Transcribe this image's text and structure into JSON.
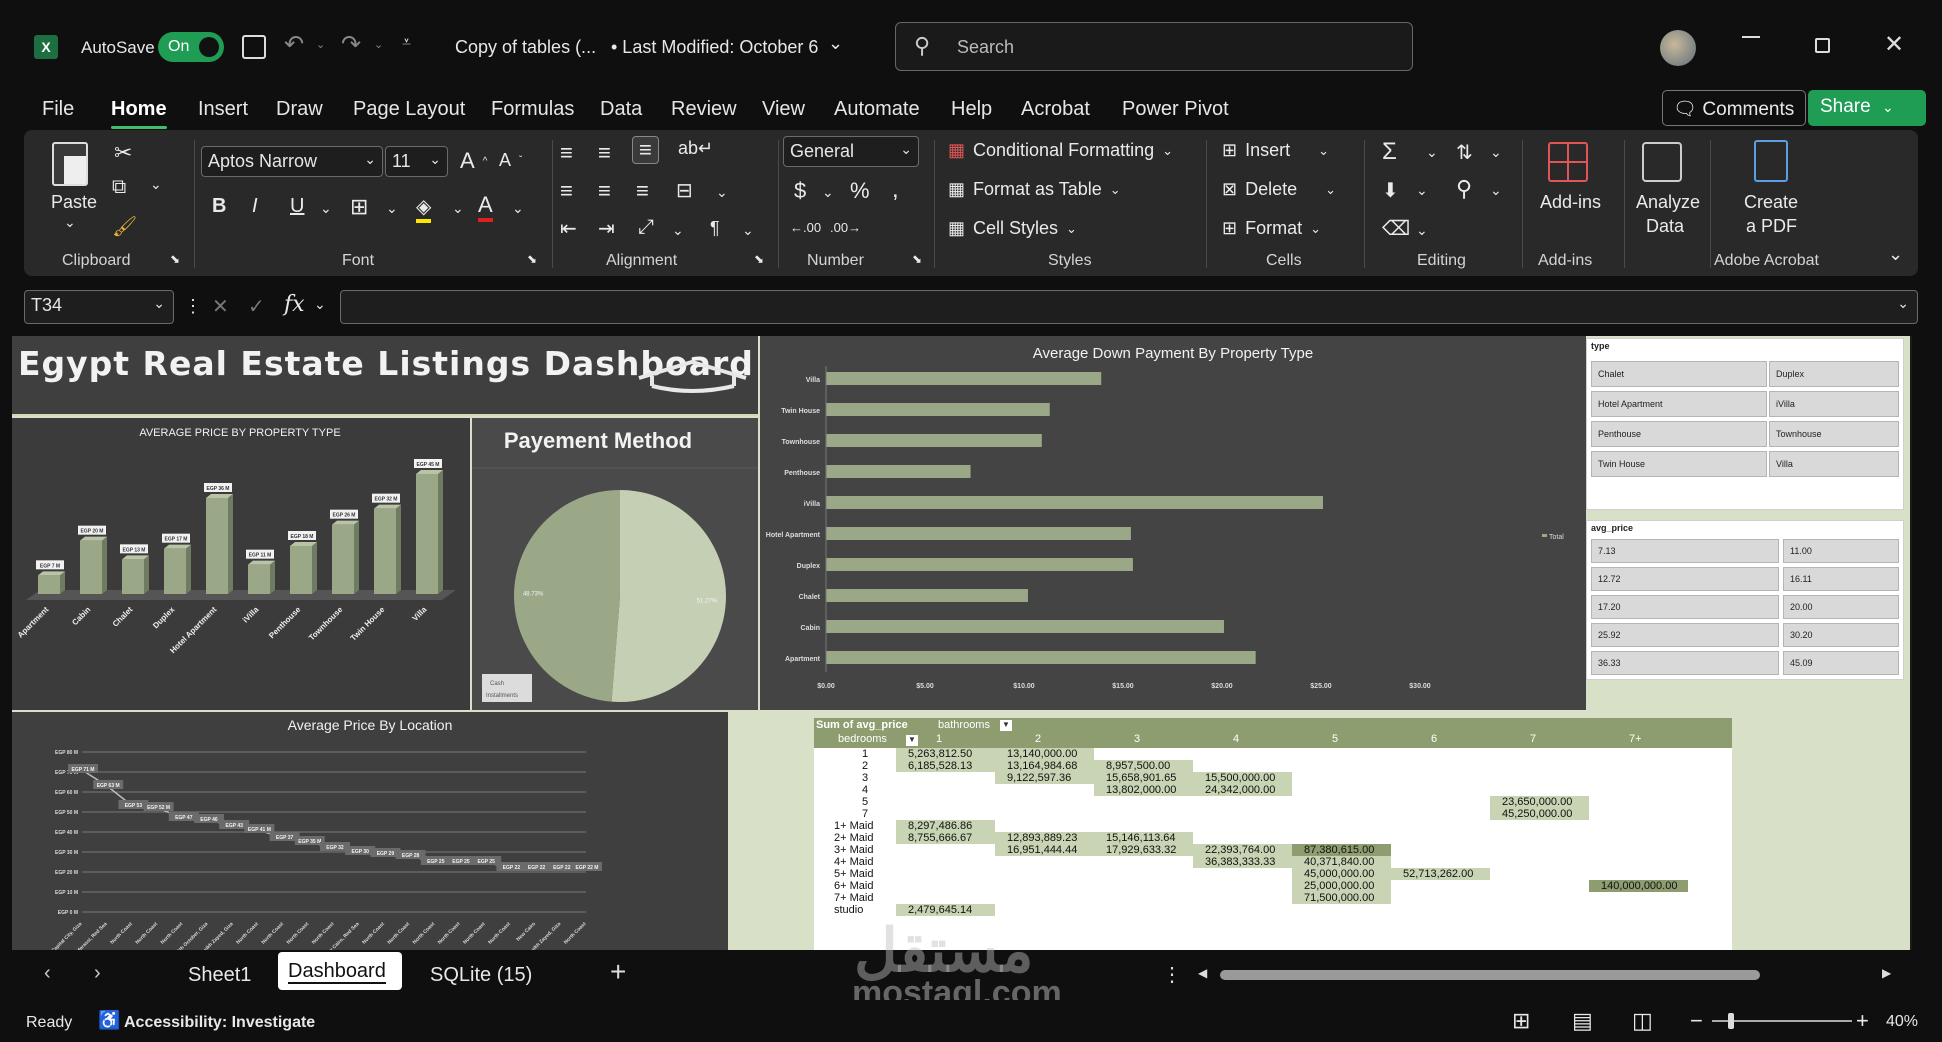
{
  "window": {
    "autosave_label": "AutoSave",
    "autosave_state": "On",
    "doc_title": "Copy of tables (...",
    "last_modified": "• Last Modified: October 6",
    "search_placeholder": "Search"
  },
  "menu": {
    "tabs": [
      "File",
      "Home",
      "Insert",
      "Draw",
      "Page Layout",
      "Formulas",
      "Data",
      "Review",
      "View",
      "Automate",
      "Help",
      "Acrobat",
      "Power Pivot"
    ],
    "comments": "Comments",
    "share": "Share"
  },
  "ribbon": {
    "clipboard": {
      "paste": "Paste",
      "label": "Clipboard"
    },
    "font": {
      "name": "Aptos Narrow",
      "size": "11",
      "label": "Font"
    },
    "alignment": {
      "label": "Alignment"
    },
    "number": {
      "format": "General",
      "label": "Number"
    },
    "styles": {
      "conditional": "Conditional Formatting",
      "format_table": "Format as Table",
      "cell_styles": "Cell Styles",
      "label": "Styles"
    },
    "cells": {
      "insert": "Insert",
      "delete": "Delete",
      "format": "Format",
      "label": "Cells"
    },
    "editing": {
      "label": "Editing"
    },
    "addins": {
      "button": "Add-ins",
      "label": "Add-ins"
    },
    "analyze": {
      "line1": "Analyze",
      "line2": "Data"
    },
    "pdf": {
      "line1": "Create",
      "line2": "a PDF",
      "label": "Adobe Acrobat"
    }
  },
  "formula_bar": {
    "name_box": "T34",
    "formula": ""
  },
  "dashboard": {
    "title": "Egypt Real Estate Listings Dashboard"
  },
  "chart_data": [
    {
      "type": "bar",
      "title": "AVERAGE PRICE BY PROPERTY TYPE",
      "categories": [
        "Apartment",
        "Cabin",
        "Chalet",
        "Duplex",
        "Hotel Apartment",
        "iVilla",
        "Penthouse",
        "Townhouse",
        "Twin House",
        "Villa"
      ],
      "values": [
        7,
        20,
        13,
        17,
        36,
        11,
        18,
        26,
        32,
        45
      ],
      "labels": [
        "EGP 7 M",
        "EGP 20 M",
        "EGP 13 M",
        "EGP 17 M",
        "EGP 36 M",
        "EGP 11 M",
        "EGP 18 M",
        "EGP 26 M",
        "EGP 32 M",
        "EGP 45 M"
      ],
      "ylim": [
        0,
        48
      ]
    },
    {
      "type": "pie",
      "title": "Payement Method",
      "slices": [
        {
          "label": "Cash",
          "value": 48.73,
          "text": "48.73%",
          "color": "#9aa888"
        },
        {
          "label": "Installments",
          "value": 51.27,
          "text": "51.27%",
          "color": "#c5cfb3"
        }
      ]
    },
    {
      "type": "bar",
      "orientation": "horizontal",
      "title": "Average Down Payment By Property Type",
      "categories": [
        "Villa",
        "Twin House",
        "Townhouse",
        "Penthouse",
        "iVilla",
        "Hotel Apartment",
        "Duplex",
        "Chalet",
        "Cabin",
        "Apartment"
      ],
      "values": [
        13.9,
        11.3,
        10.9,
        7.3,
        25.1,
        15.4,
        15.5,
        10.2,
        20.1,
        21.7
      ],
      "x_ticks": [
        "$0.00",
        "$5.00",
        "$10.00",
        "$15.00",
        "$20.00",
        "$25.00",
        "$30.00"
      ],
      "xlim": [
        0,
        30
      ],
      "legend": "Total",
      "legend_position": "right"
    },
    {
      "type": "line",
      "title": "Average Price By Location",
      "y_ticks": [
        "EGP 0 M",
        "EGP 10 M",
        "EGP 20 M",
        "EGP 30 M",
        "EGP 40 M",
        "EGP 50 M",
        "EGP 60 M",
        "EGP 70 M",
        "EGP 80 M"
      ],
      "ylim": [
        0,
        80
      ],
      "values": [
        71,
        63,
        53,
        52,
        47,
        46,
        43,
        41,
        37,
        35,
        32,
        30,
        29,
        28,
        25,
        25,
        25,
        22,
        22,
        22,
        22
      ],
      "labels": [
        "EGP 71 M",
        "EGP 63 M",
        "EGP 53",
        "EGP 52 M",
        "EGP 47",
        "EGP 46",
        "EGP 43",
        "EGP 41 M",
        "EGP 37",
        "EGP 35 M",
        "EGP 32",
        "EGP 30",
        "EGP 29",
        "EGP 28",
        "EGP 25",
        "EGP 25",
        "EGP 25",
        "EGP 22",
        "EGP 22",
        "EGP 22",
        "EGP 22 M"
      ],
      "categories": [
        "New Capital City, Giza",
        "Marassi, Red Sea",
        "North Coast",
        "North Coast",
        "North Coast",
        "6th October, Giza",
        "Sheikh Zayed, Giza",
        "North Coast",
        "North Coast",
        "North Coast",
        "North Coast",
        "New Cairo, Red Sea",
        "North Coast",
        "North Coast",
        "North Coast",
        "North Coast",
        "North Coast",
        "North Coast",
        "New Cairo",
        "Sheikh Zayed, Giza",
        "North Coast"
      ]
    }
  ],
  "slicers": {
    "type": {
      "header": "type",
      "items": [
        "Chalet",
        "Duplex",
        "Hotel Apartment",
        "iVilla",
        "Penthouse",
        "Townhouse",
        "Twin House",
        "Villa"
      ]
    },
    "price": {
      "header": "avg_price",
      "items": [
        "7.13",
        "11.00",
        "12.72",
        "16.11",
        "17.20",
        "20.00",
        "25.92",
        "30.20",
        "36.33",
        "45.09"
      ]
    }
  },
  "pivot": {
    "corner": "Sum of avg_price",
    "col_field": "bathrooms",
    "row_field": "bedrooms",
    "columns": [
      "1",
      "2",
      "3",
      "4",
      "5",
      "6",
      "7",
      "7+"
    ],
    "rows": [
      {
        "label": "1",
        "cells": [
          "5,263,812.50",
          "13,140,000.00",
          "",
          "",
          "",
          "",
          "",
          ""
        ]
      },
      {
        "label": "2",
        "cells": [
          "6,185,528.13",
          "13,164,984.68",
          "8,957,500.00",
          "",
          "",
          "",
          "",
          ""
        ]
      },
      {
        "label": "3",
        "cells": [
          "",
          "9,122,597.36",
          "15,658,901.65",
          "15,500,000.00",
          "",
          "",
          "",
          ""
        ]
      },
      {
        "label": "4",
        "cells": [
          "",
          "",
          "13,802,000.00",
          "24,342,000.00",
          "",
          "",
          "",
          ""
        ]
      },
      {
        "label": "5",
        "cells": [
          "",
          "",
          "",
          "",
          "",
          "",
          "23,650,000.00",
          ""
        ]
      },
      {
        "label": "7",
        "cells": [
          "",
          "",
          "",
          "",
          "",
          "",
          "45,250,000.00",
          ""
        ]
      },
      {
        "label": "1+ Maid",
        "cells": [
          "8,297,486.86",
          "",
          "",
          "",
          "",
          "",
          "",
          ""
        ]
      },
      {
        "label": "2+ Maid",
        "cells": [
          "8,755,666.67",
          "12,893,889.23",
          "15,146,113.64",
          "",
          "",
          "",
          "",
          ""
        ]
      },
      {
        "label": "3+ Maid",
        "cells": [
          "",
          "16,951,444.44",
          "17,929,633.32",
          "22,393,764.00",
          "87,380,615.00",
          "",
          "",
          ""
        ]
      },
      {
        "label": "4+ Maid",
        "cells": [
          "",
          "",
          "",
          "36,383,333.33",
          "40,371,840.00",
          "",
          "",
          ""
        ]
      },
      {
        "label": "5+ Maid",
        "cells": [
          "",
          "",
          "",
          "",
          "45,000,000.00",
          "52,713,262.00",
          "",
          ""
        ]
      },
      {
        "label": "6+ Maid",
        "cells": [
          "",
          "",
          "",
          "",
          "25,000,000.00",
          "",
          "",
          "140,000,000.00"
        ]
      },
      {
        "label": "7+ Maid",
        "cells": [
          "",
          "",
          "",
          "",
          "71,500,000.00",
          "",
          "",
          ""
        ]
      },
      {
        "label": "studio",
        "cells": [
          "2,479,645.14",
          "",
          "",
          "",
          "",
          "",
          "",
          ""
        ]
      }
    ]
  },
  "sheet_tabs": [
    "Sheet1",
    "Dashboard",
    "SQLite (15)"
  ],
  "status": {
    "ready": "Ready",
    "accessibility": "Accessibility: Investigate",
    "zoom": "40%"
  },
  "watermark": {
    "arabic": "مستقل",
    "latin": "mostaql.com"
  },
  "colors": {
    "accent": "#3fbf6b",
    "bar": "#9aa888",
    "panel": "#444444",
    "sheet_bg": "#d9e0c8"
  }
}
